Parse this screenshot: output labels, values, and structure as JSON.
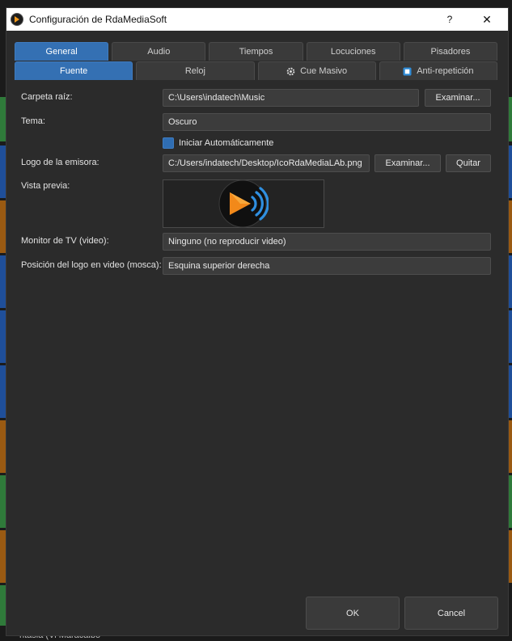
{
  "window": {
    "title": "Configuración de RdaMediaSoft",
    "help_label": "?",
    "close_label": "✕"
  },
  "tabs_row1": [
    {
      "label": "General",
      "active": true
    },
    {
      "label": "Audio",
      "active": false
    },
    {
      "label": "Tiempos",
      "active": false
    },
    {
      "label": "Locuciones",
      "active": false
    },
    {
      "label": "Pisadores",
      "active": false
    }
  ],
  "tabs_row2": [
    {
      "label": "Fuente",
      "active": true
    },
    {
      "label": "Reloj",
      "active": false
    },
    {
      "label": "Cue Masivo",
      "active": false,
      "icon": "gear-icon"
    },
    {
      "label": "Anti-repetición",
      "active": false,
      "icon": "badge-icon"
    }
  ],
  "form": {
    "root_folder_label": "Carpeta raíz:",
    "root_folder_value": "C:\\Users\\indatech\\Music",
    "browse_label": "Examinar...",
    "theme_label": "Tema:",
    "theme_value": "Oscuro",
    "autostart_label": "Iniciar Automáticamente",
    "station_logo_label": "Logo de la emisora:",
    "station_logo_value": "C:/Users/indatech/Desktop/IcoRdaMediaLAb.png",
    "logo_browse_label": "Examinar...",
    "remove_label": "Quitar",
    "preview_label": "Vista previa:",
    "tv_monitor_label": "Monitor de TV (video):",
    "tv_monitor_value": "Ninguno (no reproducir video)",
    "logo_position_label": "Posición del logo en video (mosca):",
    "logo_position_value": "Esquina superior derecha"
  },
  "buttons": {
    "ok_label": "OK",
    "cancel_label": "Cancel"
  },
  "background": {
    "bottom_text": "ntasia    (Vi Maracaibo"
  },
  "colors": {
    "accent": "#3470b3",
    "window_bg": "#2b2b2b",
    "field_bg": "#3c3c3c"
  }
}
